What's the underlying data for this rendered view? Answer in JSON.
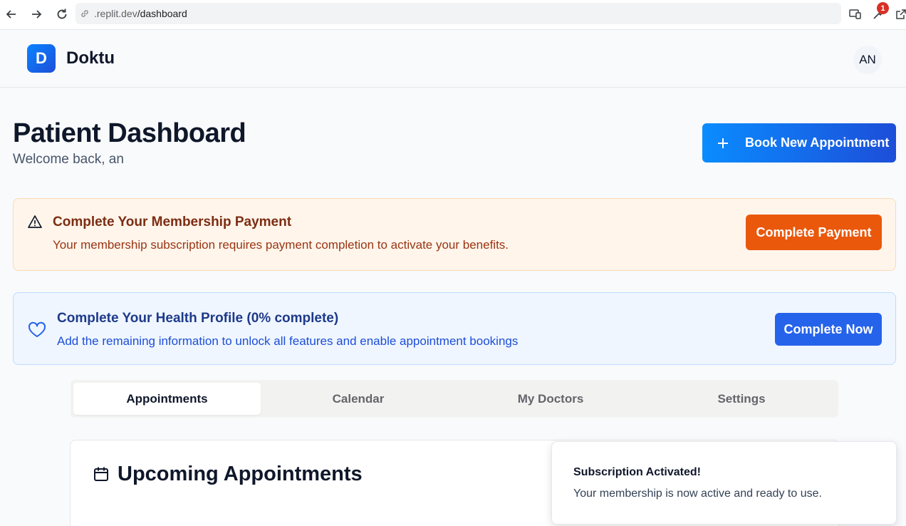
{
  "browser": {
    "url_host": ".replit.dev",
    "url_path": "/dashboard",
    "extension_badge": "1"
  },
  "header": {
    "logo_letter": "D",
    "brand": "Doktu",
    "avatar_initials": "AN"
  },
  "page": {
    "title": "Patient Dashboard",
    "subtitle": "Welcome back, an",
    "book_button": "Book New Appointment"
  },
  "payment_alert": {
    "title": "Complete Your Membership Payment",
    "description": "Your membership subscription requires payment completion to activate your benefits.",
    "button": "Complete Payment"
  },
  "health_alert": {
    "title": "Complete Your Health Profile (0% complete)",
    "description": "Add the remaining information to unlock all features and enable appointment bookings",
    "button": "Complete Now",
    "progress_percent": 0
  },
  "tabs": [
    {
      "label": "Appointments",
      "active": true
    },
    {
      "label": "Calendar",
      "active": false
    },
    {
      "label": "My Doctors",
      "active": false
    },
    {
      "label": "Settings",
      "active": false
    }
  ],
  "upcoming": {
    "title": "Upcoming Appointments"
  },
  "toast": {
    "title": "Subscription Activated!",
    "description": "Your membership is now active and ready to use."
  },
  "colors": {
    "primary": "#2563eb",
    "warning": "#ea580c"
  }
}
